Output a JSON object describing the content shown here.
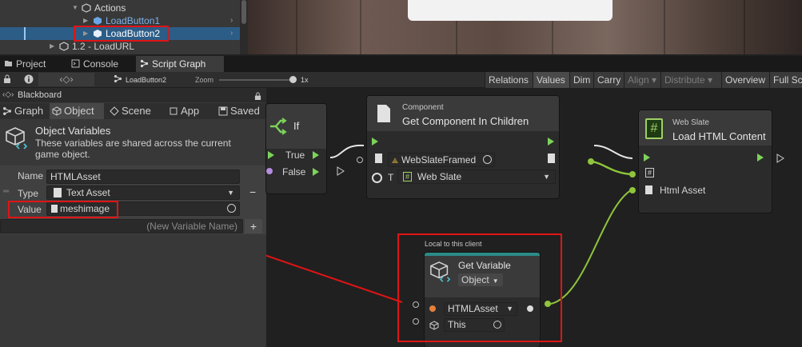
{
  "hierarchy": {
    "items": [
      {
        "label": "Actions"
      },
      {
        "label": "LoadButton1"
      },
      {
        "label": "LoadButton2"
      },
      {
        "label": "1.2 - LoadURL"
      }
    ]
  },
  "tabs": [
    {
      "label": "Project"
    },
    {
      "label": "Console"
    },
    {
      "label": "Script Graph"
    }
  ],
  "toolbar": {
    "breadcrumb": "LoadButton2",
    "zoom_label": "Zoom",
    "zoom_value": "1x",
    "buttons": [
      "Relations",
      "Values",
      "Dim",
      "Carry",
      "Align ▾",
      "Distribute ▾",
      "Overview",
      "Full Sc"
    ]
  },
  "blackboard": {
    "title": "Blackboard",
    "tabs": [
      "Graph",
      "Object",
      "Scene",
      "App",
      "Saved"
    ],
    "section_title": "Object Variables",
    "section_desc": "These variables are shared across the current game object.",
    "name_label": "Name",
    "name_value": "HTMLAsset",
    "type_label": "Type",
    "type_value": "Text Asset",
    "value_label": "Value",
    "value_value": "meshimage",
    "new_var_placeholder": "(New Variable Name)"
  },
  "nodes": {
    "if": {
      "title": "If",
      "true_label": "True",
      "false_label": "False"
    },
    "component": {
      "subtitle": "Component",
      "title": "Get Component In Children",
      "target_value": "WebSlateFramed",
      "type_prefix": "T",
      "type_value": "Web Slate"
    },
    "webslate": {
      "subtitle": "Web Slate",
      "title": "Load HTML Content",
      "html_label": "Html Asset",
      "hash": "#"
    },
    "getvar": {
      "caption": "Local to this client",
      "title": "Get Variable",
      "kind": "Object",
      "name_value": "HTMLAsset",
      "target_value": "This"
    }
  },
  "colors": {
    "accent_red": "#e01414",
    "flow_green": "#7cd35a",
    "value_green": "#8fc53c"
  }
}
